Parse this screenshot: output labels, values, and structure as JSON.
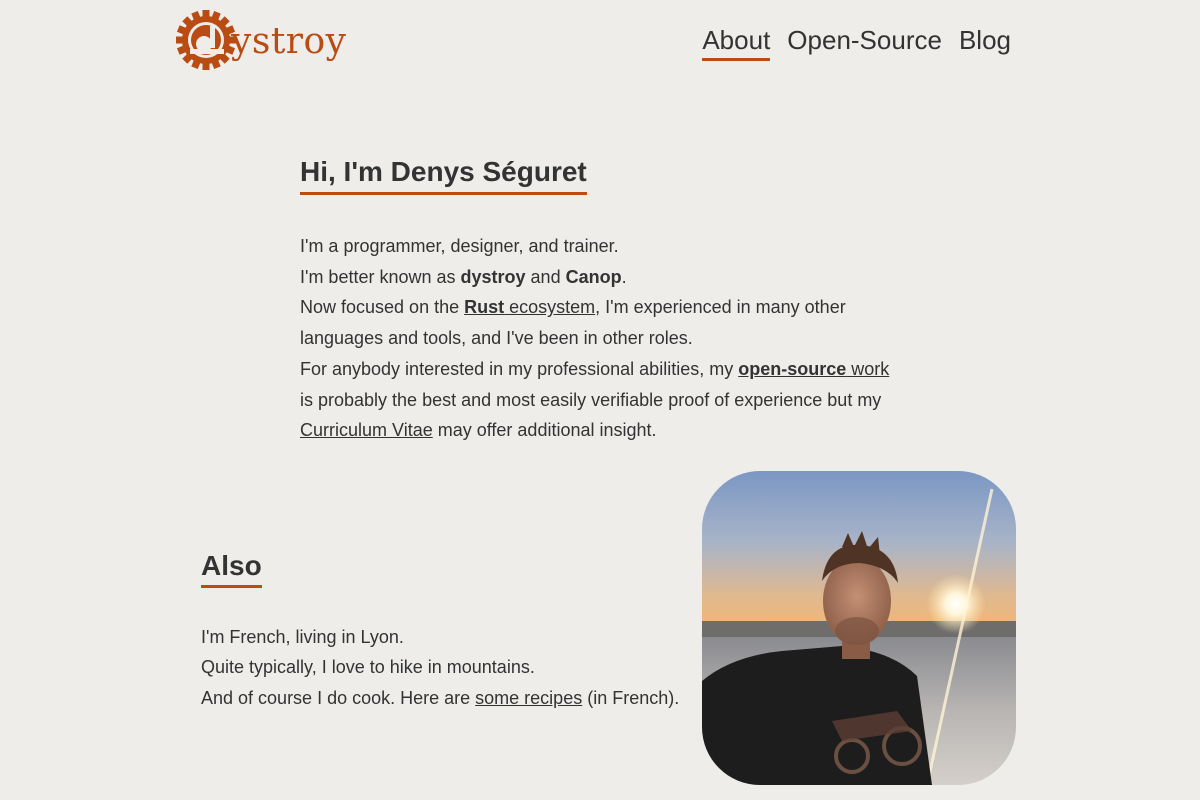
{
  "header": {
    "logo_text": "ystroy",
    "nav": [
      {
        "label": "About",
        "active": true
      },
      {
        "label": "Open-Source",
        "active": false
      },
      {
        "label": "Blog",
        "active": false
      }
    ]
  },
  "intro": {
    "title": "Hi, I'm Denys Séguret",
    "line1": "I'm a programmer, designer, and trainer.",
    "line2_pre": "I'm better known as ",
    "line2_bold1": "dystroy",
    "line2_mid": " and ",
    "line2_bold2": "Canop",
    "line2_post": ".",
    "line3_pre": "Now focused on the ",
    "line3_link_bold": "Rust",
    "line3_link_rest": " ecosystem",
    "line3_post": ", I'm experienced in many other languages and tools, and I've been in other roles.",
    "line4_pre": "For anybody interested in my professional abilities, my ",
    "line4_link_bold": "open-source",
    "line4_link_rest": " work",
    "line4_post": " is probably the best and most easily verifiable proof of experience but my ",
    "line4_link2": "Curriculum Vitae",
    "line4_end": " may offer additional insight."
  },
  "also": {
    "title": "Also",
    "line1": "I'm French, living in Lyon.",
    "line2": "Quite typically, I love to hike in mountains.",
    "line3_pre": "And of course I do cook. Here are ",
    "line3_link": "some recipes",
    "line3_post": " (in French)."
  },
  "colors": {
    "accent": "#b94c13",
    "background": "#eeedea",
    "text": "#333333"
  },
  "icons": {
    "logo": "gear-d-logo-icon"
  }
}
